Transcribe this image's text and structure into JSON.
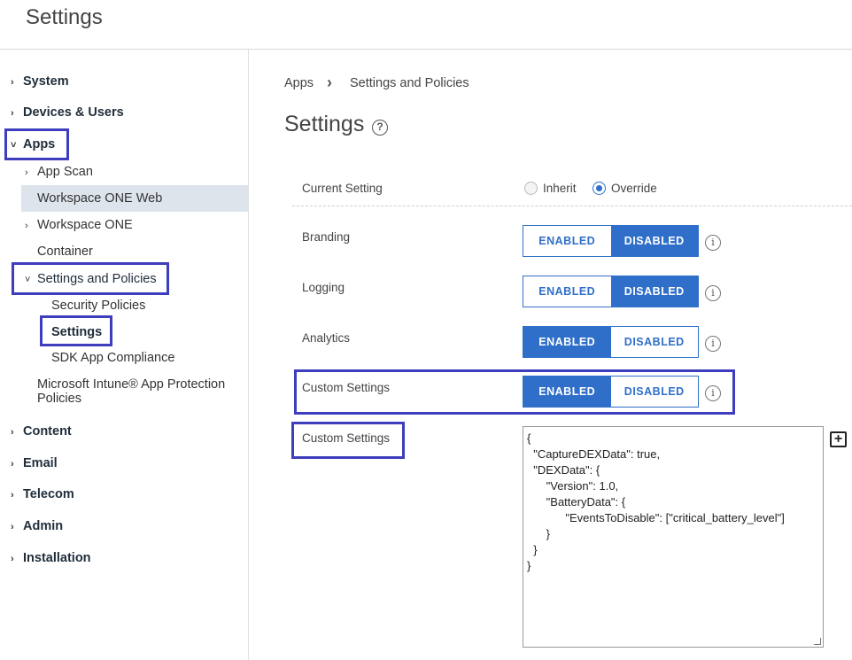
{
  "header": {
    "title": "Settings"
  },
  "sidebar": {
    "items": [
      {
        "label": "System"
      },
      {
        "label": "Devices & Users"
      },
      {
        "label": "Apps"
      },
      {
        "label": "App Scan"
      },
      {
        "label": "Workspace ONE Web"
      },
      {
        "label": "Workspace ONE"
      },
      {
        "label": "Container"
      },
      {
        "label": "Settings and Policies"
      },
      {
        "label": "Security Policies"
      },
      {
        "label": "Settings"
      },
      {
        "label": "SDK App Compliance"
      },
      {
        "label": "Microsoft Intune® App Protection"
      },
      {
        "label": "Policies"
      },
      {
        "label": "Content"
      },
      {
        "label": "Email"
      },
      {
        "label": "Telecom"
      },
      {
        "label": "Admin"
      },
      {
        "label": "Installation"
      }
    ]
  },
  "breadcrumb": {
    "root": "Apps",
    "separator": "›",
    "current": "Settings and Policies"
  },
  "main": {
    "title": "Settings",
    "help_icon": "?",
    "current_setting": {
      "label": "Current Setting",
      "options": [
        "Inherit",
        "Override"
      ],
      "selected": "Override"
    },
    "toggles": [
      {
        "label": "Branding",
        "enabled": "ENABLED",
        "disabled": "DISABLED",
        "value": "DISABLED"
      },
      {
        "label": "Logging",
        "enabled": "ENABLED",
        "disabled": "DISABLED",
        "value": "DISABLED"
      },
      {
        "label": "Analytics",
        "enabled": "ENABLED",
        "disabled": "DISABLED",
        "value": "ENABLED"
      },
      {
        "label": "Custom Settings",
        "enabled": "ENABLED",
        "disabled": "DISABLED",
        "value": "ENABLED"
      }
    ],
    "info_icon": "i",
    "custom_settings_label": "Custom Settings",
    "custom_settings_lines": [
      "{",
      "  \"CaptureDEXData\": true,",
      "  \"DEXData\": {",
      "      \"Version\": 1.0,",
      "      \"BatteryData\": {",
      "            \"EventsToDisable\": [\"critical_battery_level\"]",
      "      }",
      "  }",
      "}"
    ],
    "add_icon": "+"
  },
  "colors": {
    "accent": "#2f6fca",
    "highlight": "#3d3dbd",
    "selected_bg": "#dde4ec"
  }
}
